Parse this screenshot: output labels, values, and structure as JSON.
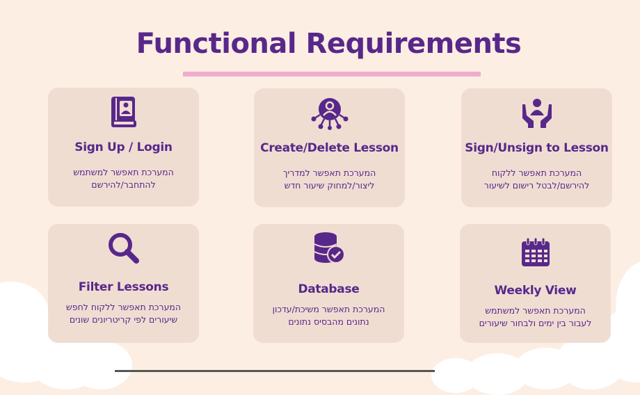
{
  "page": {
    "title": "Functional Requirements",
    "colors": {
      "accent": "#57288a",
      "card": "#f0ddd2",
      "underline": "#f0acd0",
      "background": "#fdeee3"
    }
  },
  "cards": [
    {
      "icon": "user-book-icon",
      "title": "Sign Up / Login",
      "desc_1": "המערכת תאפשר למשתמש",
      "desc_2": "להתחבר/להירשם"
    },
    {
      "icon": "user-network-icon",
      "title": "Create/Delete Lesson",
      "desc_1": "המערכת תאפשר למדריך",
      "desc_2": "ליצור/למחוק שיעור חדש"
    },
    {
      "icon": "hands-user-icon",
      "title": "Sign/Unsign to Lesson",
      "desc_1": "המערכת תאפשר ללקוח",
      "desc_2": "להירשם/לבטל רישום לשיעור"
    },
    {
      "icon": "magnifier-icon",
      "title": "Filter Lessons",
      "desc_1": "המערכת תאפשר ללקוח לחפש",
      "desc_2": "שיעורים לפי קריטריונים שונים"
    },
    {
      "icon": "database-check-icon",
      "title": "Database",
      "desc_1": "המערכת תאפשר משיכת/עדכון",
      "desc_2": "נתונים מהבסיס נתונים"
    },
    {
      "icon": "calendar-icon",
      "title": "Weekly View",
      "desc_1": "המערכת תאפשר למשתמש",
      "desc_2": "לעבור בין ימים ולבחור שיעורים"
    }
  ]
}
